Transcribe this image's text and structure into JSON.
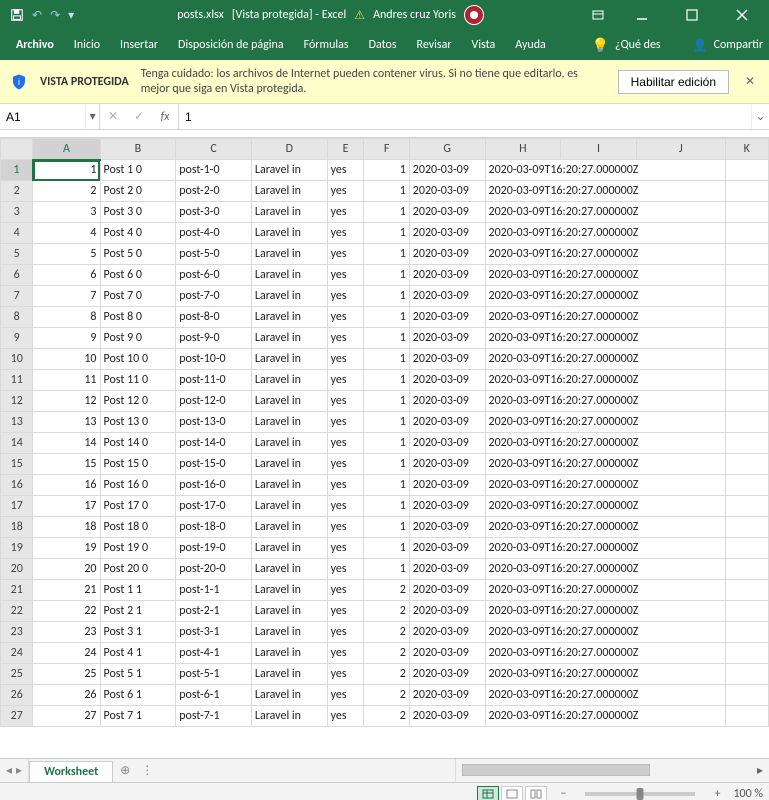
{
  "title_bar": {
    "filename": "posts.xlsx",
    "suffix": "[Vista protegida] - Excel",
    "username": "Andres cruz Yoris"
  },
  "ribbon": {
    "tabs": [
      "Archivo",
      "Inicio",
      "Insertar",
      "Disposición de página",
      "Fórmulas",
      "Datos",
      "Revisar",
      "Vista",
      "Ayuda"
    ],
    "tell_me": "¿Qué des",
    "share": "Compartir"
  },
  "banner": {
    "title": "VISTA PROTEGIDA",
    "message": "Tenga cuidado: los archivos de Internet pueden contener virus. Si no tiene que editarlo, es mejor que siga en Vista protegida.",
    "button": "Habilitar edición"
  },
  "formula": {
    "cell_ref": "A1",
    "value": "1"
  },
  "columns": [
    "A",
    "B",
    "C",
    "D",
    "E",
    "F",
    "G",
    "H",
    "I",
    "J",
    "K"
  ],
  "sheet": {
    "active_tab": "Worksheet",
    "zoom": "100 %"
  },
  "rows": [
    {
      "n": 1,
      "a": "1",
      "b": "Post 1 0",
      "c": "post-1-0",
      "d": "Laravel in",
      "e": "yes",
      "f": "1",
      "g": "2020-03-09",
      "h": "2020-03-09T16:20:27.000000Z"
    },
    {
      "n": 2,
      "a": "2",
      "b": "Post 2 0",
      "c": "post-2-0",
      "d": "Laravel in",
      "e": "yes",
      "f": "1",
      "g": "2020-03-09",
      "h": "2020-03-09T16:20:27.000000Z"
    },
    {
      "n": 3,
      "a": "3",
      "b": "Post 3 0",
      "c": "post-3-0",
      "d": "Laravel in",
      "e": "yes",
      "f": "1",
      "g": "2020-03-09",
      "h": "2020-03-09T16:20:27.000000Z"
    },
    {
      "n": 4,
      "a": "4",
      "b": "Post 4 0",
      "c": "post-4-0",
      "d": "Laravel in",
      "e": "yes",
      "f": "1",
      "g": "2020-03-09",
      "h": "2020-03-09T16:20:27.000000Z"
    },
    {
      "n": 5,
      "a": "5",
      "b": "Post 5 0",
      "c": "post-5-0",
      "d": "Laravel in",
      "e": "yes",
      "f": "1",
      "g": "2020-03-09",
      "h": "2020-03-09T16:20:27.000000Z"
    },
    {
      "n": 6,
      "a": "6",
      "b": "Post 6 0",
      "c": "post-6-0",
      "d": "Laravel in",
      "e": "yes",
      "f": "1",
      "g": "2020-03-09",
      "h": "2020-03-09T16:20:27.000000Z"
    },
    {
      "n": 7,
      "a": "7",
      "b": "Post 7 0",
      "c": "post-7-0",
      "d": "Laravel in",
      "e": "yes",
      "f": "1",
      "g": "2020-03-09",
      "h": "2020-03-09T16:20:27.000000Z"
    },
    {
      "n": 8,
      "a": "8",
      "b": "Post 8 0",
      "c": "post-8-0",
      "d": "Laravel in",
      "e": "yes",
      "f": "1",
      "g": "2020-03-09",
      "h": "2020-03-09T16:20:27.000000Z"
    },
    {
      "n": 9,
      "a": "9",
      "b": "Post 9 0",
      "c": "post-9-0",
      "d": "Laravel in",
      "e": "yes",
      "f": "1",
      "g": "2020-03-09",
      "h": "2020-03-09T16:20:27.000000Z"
    },
    {
      "n": 10,
      "a": "10",
      "b": "Post 10 0",
      "c": "post-10-0",
      "d": "Laravel in",
      "e": "yes",
      "f": "1",
      "g": "2020-03-09",
      "h": "2020-03-09T16:20:27.000000Z"
    },
    {
      "n": 11,
      "a": "11",
      "b": "Post 11 0",
      "c": "post-11-0",
      "d": "Laravel in",
      "e": "yes",
      "f": "1",
      "g": "2020-03-09",
      "h": "2020-03-09T16:20:27.000000Z"
    },
    {
      "n": 12,
      "a": "12",
      "b": "Post 12 0",
      "c": "post-12-0",
      "d": "Laravel in",
      "e": "yes",
      "f": "1",
      "g": "2020-03-09",
      "h": "2020-03-09T16:20:27.000000Z"
    },
    {
      "n": 13,
      "a": "13",
      "b": "Post 13 0",
      "c": "post-13-0",
      "d": "Laravel in",
      "e": "yes",
      "f": "1",
      "g": "2020-03-09",
      "h": "2020-03-09T16:20:27.000000Z"
    },
    {
      "n": 14,
      "a": "14",
      "b": "Post 14 0",
      "c": "post-14-0",
      "d": "Laravel in",
      "e": "yes",
      "f": "1",
      "g": "2020-03-09",
      "h": "2020-03-09T16:20:27.000000Z"
    },
    {
      "n": 15,
      "a": "15",
      "b": "Post 15 0",
      "c": "post-15-0",
      "d": "Laravel in",
      "e": "yes",
      "f": "1",
      "g": "2020-03-09",
      "h": "2020-03-09T16:20:27.000000Z"
    },
    {
      "n": 16,
      "a": "16",
      "b": "Post 16 0",
      "c": "post-16-0",
      "d": "Laravel in",
      "e": "yes",
      "f": "1",
      "g": "2020-03-09",
      "h": "2020-03-09T16:20:27.000000Z"
    },
    {
      "n": 17,
      "a": "17",
      "b": "Post 17 0",
      "c": "post-17-0",
      "d": "Laravel in",
      "e": "yes",
      "f": "1",
      "g": "2020-03-09",
      "h": "2020-03-09T16:20:27.000000Z"
    },
    {
      "n": 18,
      "a": "18",
      "b": "Post 18 0",
      "c": "post-18-0",
      "d": "Laravel in",
      "e": "yes",
      "f": "1",
      "g": "2020-03-09",
      "h": "2020-03-09T16:20:27.000000Z"
    },
    {
      "n": 19,
      "a": "19",
      "b": "Post 19 0",
      "c": "post-19-0",
      "d": "Laravel in",
      "e": "yes",
      "f": "1",
      "g": "2020-03-09",
      "h": "2020-03-09T16:20:27.000000Z"
    },
    {
      "n": 20,
      "a": "20",
      "b": "Post 20 0",
      "c": "post-20-0",
      "d": "Laravel in",
      "e": "yes",
      "f": "1",
      "g": "2020-03-09",
      "h": "2020-03-09T16:20:27.000000Z"
    },
    {
      "n": 21,
      "a": "21",
      "b": "Post 1 1",
      "c": "post-1-1",
      "d": "Laravel in",
      "e": "yes",
      "f": "2",
      "g": "2020-03-09",
      "h": "2020-03-09T16:20:27.000000Z"
    },
    {
      "n": 22,
      "a": "22",
      "b": "Post 2 1",
      "c": "post-2-1",
      "d": "Laravel in",
      "e": "yes",
      "f": "2",
      "g": "2020-03-09",
      "h": "2020-03-09T16:20:27.000000Z"
    },
    {
      "n": 23,
      "a": "23",
      "b": "Post 3 1",
      "c": "post-3-1",
      "d": "Laravel in",
      "e": "yes",
      "f": "2",
      "g": "2020-03-09",
      "h": "2020-03-09T16:20:27.000000Z"
    },
    {
      "n": 24,
      "a": "24",
      "b": "Post 4 1",
      "c": "post-4-1",
      "d": "Laravel in",
      "e": "yes",
      "f": "2",
      "g": "2020-03-09",
      "h": "2020-03-09T16:20:27.000000Z"
    },
    {
      "n": 25,
      "a": "25",
      "b": "Post 5 1",
      "c": "post-5-1",
      "d": "Laravel in",
      "e": "yes",
      "f": "2",
      "g": "2020-03-09",
      "h": "2020-03-09T16:20:27.000000Z"
    },
    {
      "n": 26,
      "a": "26",
      "b": "Post 6 1",
      "c": "post-6-1",
      "d": "Laravel in",
      "e": "yes",
      "f": "2",
      "g": "2020-03-09",
      "h": "2020-03-09T16:20:27.000000Z"
    },
    {
      "n": 27,
      "a": "27",
      "b": "Post 7 1",
      "c": "post-7-1",
      "d": "Laravel in",
      "e": "yes",
      "f": "2",
      "g": "2020-03-09",
      "h": "2020-03-09T16:20:27.000000Z"
    }
  ]
}
